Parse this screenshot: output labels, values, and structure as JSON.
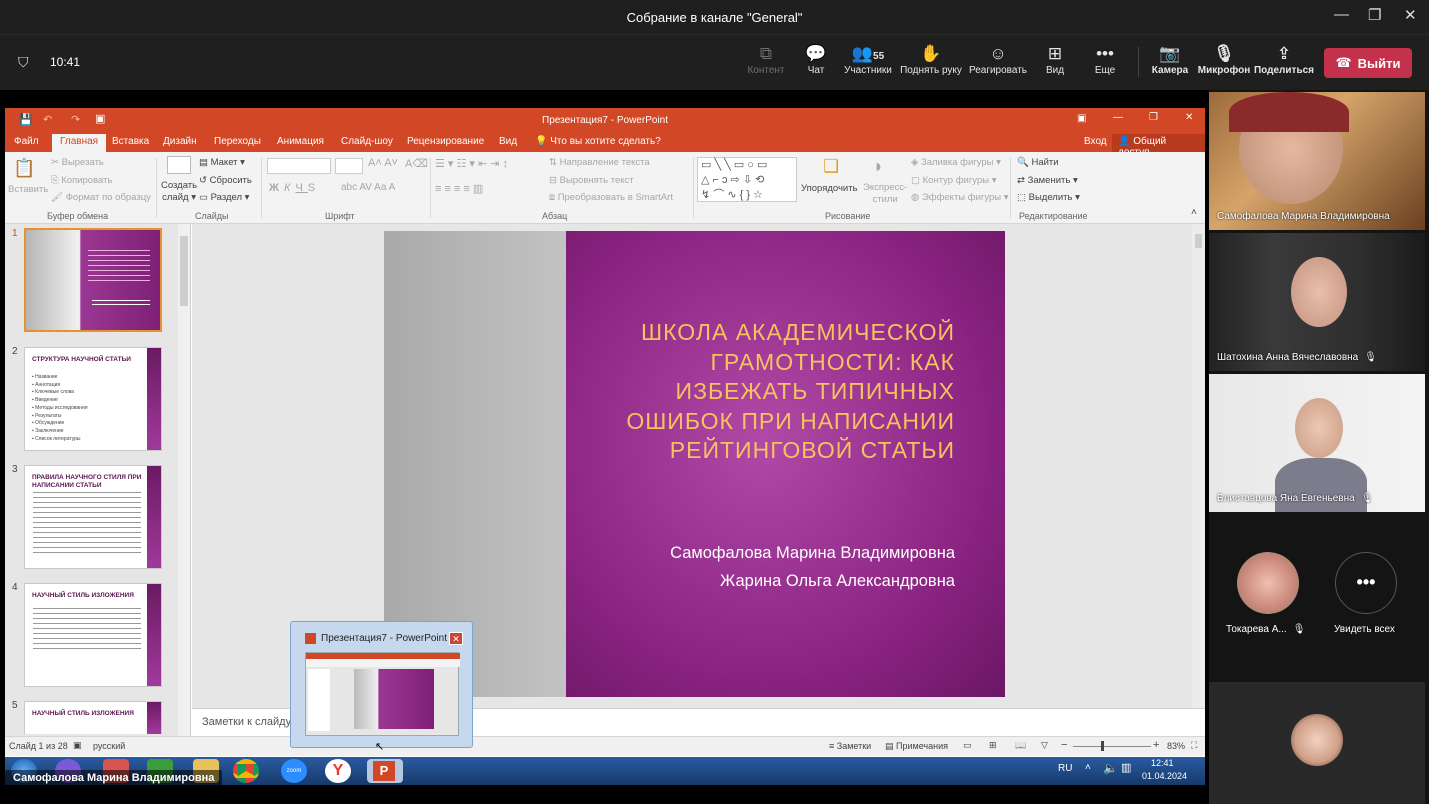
{
  "teams": {
    "window_title": "Собрание в канале \"General\"",
    "time": "10:41",
    "toolbar": {
      "content": "Контент",
      "chat": "Чат",
      "participants": "Участники",
      "participants_count": "55",
      "raise_hand": "Поднять руку",
      "react": "Реагировать",
      "view": "Вид",
      "more": "Еще",
      "camera": "Камера",
      "mic": "Микрофон",
      "share": "Поделиться",
      "leave": "Выйти"
    },
    "presenter_label": "Самофалова Марина Владимировна"
  },
  "participants": [
    {
      "name": "Самофалова Марина Владимировна",
      "muted": false
    },
    {
      "name": "Шатохина Анна Вячеславовна",
      "muted": true
    },
    {
      "name": "Блиставцова Яна Евгеньевна",
      "muted": true
    },
    {
      "name": "Токарева А...",
      "muted": true
    }
  ],
  "see_all": "Увидеть всех",
  "powerpoint": {
    "title": "Презентация7 - PowerPoint",
    "tabs": [
      "Файл",
      "Главная",
      "Вставка",
      "Дизайн",
      "Переходы",
      "Анимация",
      "Слайд-шоу",
      "Рецензирование",
      "Вид"
    ],
    "active_tab": "Главная",
    "tell_me": "Что вы хотите сделать?",
    "sign_in": "Вход",
    "share": "Общий доступ",
    "ribbon": {
      "paste": "Вставить",
      "cut": "Вырезать",
      "copy": "Копировать",
      "format_painter": "Формат по образцу",
      "clipboard": "Буфер обмена",
      "new_slide": "Создать",
      "new_slide2": "слайд",
      "layout": "Макет",
      "reset": "Сбросить",
      "section": "Раздел",
      "slides": "Слайды",
      "font": "Шрифт",
      "text_direction": "Направление текста",
      "align_text": "Выровнять текст",
      "smartart": "Преобразовать в SmartArt",
      "paragraph": "Абзац",
      "arrange": "Упорядочить",
      "quick_styles": "Экспресс-",
      "quick_styles2": "стили",
      "shape_fill": "Заливка фигуры",
      "shape_outline": "Контур фигуры",
      "shape_effects": "Эффекты фигуры",
      "drawing": "Рисование",
      "find": "Найти",
      "replace": "Заменить",
      "select": "Выделить",
      "editing": "Редактирование"
    },
    "thumbnails": [
      {
        "num": "1",
        "title": ""
      },
      {
        "num": "2",
        "title": "СТРУКТУРА НАУЧНОЙ СТАТЬИ",
        "lines": "▪ Название\n▪ Аннотация\n▪ Ключевые слова\n▪ Введение\n▪ Методы исследования\n▪ Результаты\n▪ Обсуждение\n▪ Заключение\n▪ Список литературы"
      },
      {
        "num": "3",
        "title": "ПРАВИЛА НАУЧНОГО СТИЛЯ ПРИ НАПИСАНИИ СТАТЬИ"
      },
      {
        "num": "4",
        "title": "НАУЧНЫЙ СТИЛЬ ИЗЛОЖЕНИЯ"
      },
      {
        "num": "5",
        "title": "НАУЧНЫЙ СТИЛЬ ИЗЛОЖЕНИЯ"
      }
    ],
    "slide": {
      "title": "ШКОЛА АКАДЕМИЧЕСКОЙ ГРАМОТНОСТИ: КАК ИЗБЕЖАТЬ ТИПИЧНЫХ ОШИБОК ПРИ НАПИСАНИИ РЕЙТИНГОВОЙ СТАТЬИ",
      "author1": "Самофалова Марина Владимировна",
      "author2": "Жарина Ольга Александровна"
    },
    "notes_placeholder": "Заметки к слайду",
    "status": {
      "slide_info": "Слайд 1 из 28",
      "language": "русский",
      "notes": "Заметки",
      "comments": "Примечания",
      "zoom": "83%"
    }
  },
  "taskbar": {
    "popup_title": "Презентация7 - PowerPoint",
    "lang": "RU",
    "clock_time": "12:41",
    "clock_date": "01.04.2024",
    "zoom_label": "zoom"
  }
}
